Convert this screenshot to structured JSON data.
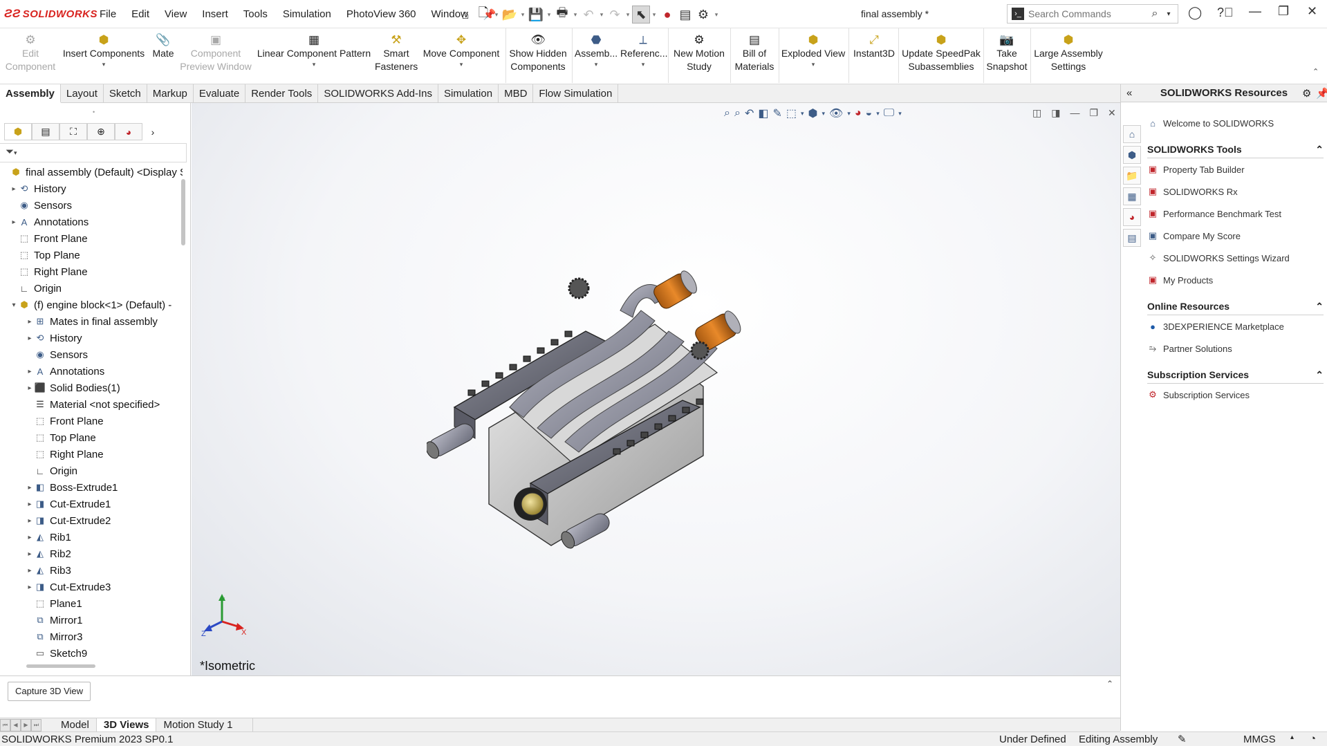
{
  "app": {
    "logo": "SOLIDWORKS",
    "document_title": "final assembly *"
  },
  "menu": [
    "File",
    "Edit",
    "View",
    "Insert",
    "Tools",
    "Simulation",
    "PhotoView 360",
    "Window"
  ],
  "search": {
    "placeholder": "Search Commands"
  },
  "command_manager": [
    {
      "label1": "Edit",
      "label2": "Component",
      "icon": "edit-component-icon",
      "disabled": true
    },
    {
      "label1": "Insert Components",
      "label2": "",
      "icon": "insert-components-icon",
      "dd": true
    },
    {
      "label1": "Mate",
      "label2": "",
      "icon": "mate-icon"
    },
    {
      "label1": "Component",
      "label2": "Preview Window",
      "icon": "preview-window-icon",
      "disabled": true
    },
    {
      "label1": "Linear Component Pattern",
      "label2": "",
      "icon": "linear-pattern-icon",
      "dd": true
    },
    {
      "label1": "Smart",
      "label2": "Fasteners",
      "icon": "smart-fasteners-icon"
    },
    {
      "label1": "Move Component",
      "label2": "",
      "icon": "move-component-icon",
      "dd": true
    },
    {
      "label1": "Show Hidden",
      "label2": "Components",
      "icon": "show-hidden-icon"
    },
    {
      "label1": "Assemb...",
      "label2": "",
      "icon": "assembly-features-icon",
      "dd": true
    },
    {
      "label1": "Referenc...",
      "label2": "",
      "icon": "reference-geometry-icon",
      "dd": true
    },
    {
      "label1": "New Motion",
      "label2": "Study",
      "icon": "motion-study-icon"
    },
    {
      "label1": "Bill of",
      "label2": "Materials",
      "icon": "bom-icon"
    },
    {
      "label1": "Exploded View",
      "label2": "",
      "icon": "exploded-view-icon",
      "dd": true
    },
    {
      "label1": "Instant3D",
      "label2": "",
      "icon": "instant3d-icon"
    },
    {
      "label1": "Update SpeedPak",
      "label2": "Subassemblies",
      "icon": "speedpak-icon"
    },
    {
      "label1": "Take",
      "label2": "Snapshot",
      "icon": "snapshot-icon"
    },
    {
      "label1": "Large Assembly",
      "label2": "Settings",
      "icon": "large-assembly-icon"
    }
  ],
  "tabs": [
    "Assembly",
    "Layout",
    "Sketch",
    "Markup",
    "Evaluate",
    "Render Tools",
    "SOLIDWORKS Add-Ins",
    "Simulation",
    "MBD",
    "Flow Simulation"
  ],
  "feature_tree": [
    {
      "label": "final assembly (Default) <Display S",
      "indent": 0,
      "expand": "",
      "icon": "assembly-icon"
    },
    {
      "label": "History",
      "indent": 1,
      "expand": "▸",
      "icon": "history-icon"
    },
    {
      "label": "Sensors",
      "indent": 1,
      "expand": "",
      "icon": "sensors-icon"
    },
    {
      "label": "Annotations",
      "indent": 1,
      "expand": "▸",
      "icon": "annotations-icon"
    },
    {
      "label": "Front Plane",
      "indent": 1,
      "expand": "",
      "icon": "plane-icon"
    },
    {
      "label": "Top Plane",
      "indent": 1,
      "expand": "",
      "icon": "plane-icon"
    },
    {
      "label": "Right Plane",
      "indent": 1,
      "expand": "",
      "icon": "plane-icon"
    },
    {
      "label": "Origin",
      "indent": 1,
      "expand": "",
      "icon": "origin-icon"
    },
    {
      "label": "(f) engine block<1> (Default) -",
      "indent": 1,
      "expand": "▾",
      "icon": "part-icon"
    },
    {
      "label": "Mates in final assembly",
      "indent": 2,
      "expand": "▸",
      "icon": "mates-icon"
    },
    {
      "label": "History",
      "indent": 2,
      "expand": "▸",
      "icon": "history-icon"
    },
    {
      "label": "Sensors",
      "indent": 2,
      "expand": "",
      "icon": "sensors-icon"
    },
    {
      "label": "Annotations",
      "indent": 2,
      "expand": "▸",
      "icon": "annotations-icon"
    },
    {
      "label": "Solid Bodies(1)",
      "indent": 2,
      "expand": "▸",
      "icon": "solid-bodies-icon"
    },
    {
      "label": "Material <not specified>",
      "indent": 2,
      "expand": "",
      "icon": "material-icon"
    },
    {
      "label": "Front Plane",
      "indent": 2,
      "expand": "",
      "icon": "plane-icon"
    },
    {
      "label": "Top Plane",
      "indent": 2,
      "expand": "",
      "icon": "plane-icon"
    },
    {
      "label": "Right Plane",
      "indent": 2,
      "expand": "",
      "icon": "plane-icon"
    },
    {
      "label": "Origin",
      "indent": 2,
      "expand": "",
      "icon": "origin-icon"
    },
    {
      "label": "Boss-Extrude1",
      "indent": 2,
      "expand": "▸",
      "icon": "extrude-icon"
    },
    {
      "label": "Cut-Extrude1",
      "indent": 2,
      "expand": "▸",
      "icon": "cut-icon"
    },
    {
      "label": "Cut-Extrude2",
      "indent": 2,
      "expand": "▸",
      "icon": "cut-icon"
    },
    {
      "label": "Rib1",
      "indent": 2,
      "expand": "▸",
      "icon": "rib-icon"
    },
    {
      "label": "Rib2",
      "indent": 2,
      "expand": "▸",
      "icon": "rib-icon"
    },
    {
      "label": "Rib3",
      "indent": 2,
      "expand": "▸",
      "icon": "rib-icon"
    },
    {
      "label": "Cut-Extrude3",
      "indent": 2,
      "expand": "▸",
      "icon": "cut-icon"
    },
    {
      "label": "Plane1",
      "indent": 2,
      "expand": "",
      "icon": "plane-icon"
    },
    {
      "label": "Mirror1",
      "indent": 2,
      "expand": "",
      "icon": "mirror-icon"
    },
    {
      "label": "Mirror3",
      "indent": 2,
      "expand": "",
      "icon": "mirror-icon"
    },
    {
      "label": "Sketch9",
      "indent": 2,
      "expand": "",
      "icon": "sketch-icon"
    }
  ],
  "viewport": {
    "view_label": "*Isometric",
    "axes": {
      "x": "X",
      "y": "Y",
      "z": "Z"
    }
  },
  "task_pane": {
    "title": "SOLIDWORKS Resources",
    "welcome": "Welcome to SOLIDWORKS",
    "sections": [
      {
        "title": "SOLIDWORKS Tools",
        "items": [
          "Property Tab Builder",
          "SOLIDWORKS Rx",
          "Performance Benchmark Test",
          "Compare My Score",
          "SOLIDWORKS Settings Wizard",
          "My Products"
        ]
      },
      {
        "title": "Online Resources",
        "items": [
          "3DEXPERIENCE Marketplace",
          "Partner Solutions"
        ]
      },
      {
        "title": "Subscription Services",
        "items": [
          "Subscription Services"
        ]
      }
    ]
  },
  "bottom_panel": {
    "capture_button": "Capture 3D View"
  },
  "bottom_tabs": [
    "Model",
    "3D Views",
    "Motion Study 1"
  ],
  "status": {
    "product": "SOLIDWORKS Premium 2023 SP0.1",
    "state": "Under Defined",
    "mode": "Editing Assembly",
    "units": "MMGS"
  }
}
